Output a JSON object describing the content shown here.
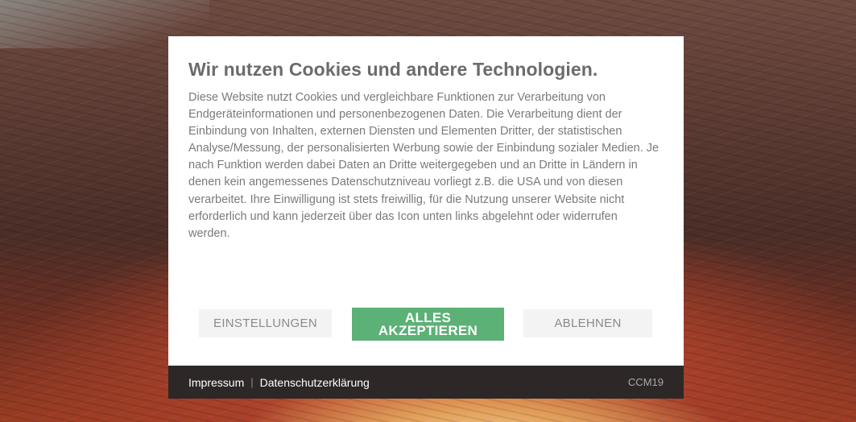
{
  "consent_modal": {
    "title": "Wir nutzen Cookies und andere Technologien.",
    "description": "Diese Website nutzt Cookies und vergleichbare Funktionen zur Verarbeitung von Endgeräteinformationen und personenbezogenen Daten. Die Verarbeitung dient der Einbindung von Inhalten, externen Diensten und Elementen Dritter, der statistischen Analyse/Messung, der personalisierten Werbung sowie der Einbindung sozialer Medien. Je nach Funktion werden dabei Daten an Dritte weitergegeben und an Dritte in Ländern in denen kein angemessenes Datenschutzniveau vorliegt z.B. die USA und von diesen verarbeitet. Ihre Einwilligung ist stets freiwillig, für die Nutzung unserer Website nicht erforderlich und kann jederzeit über das Icon unten links abgelehnt oder widerrufen werden.",
    "buttons": {
      "settings_label": "EINSTELLUNGEN",
      "accept_all_label": "ALLES AKZEPTIEREN",
      "reject_label": "ABLEHNEN"
    },
    "colors": {
      "accept_button": "#5cb176",
      "secondary_button": "#f3f3f3",
      "footer_background": "#2d2827"
    }
  },
  "footer": {
    "imprint_label": "Impressum",
    "separator": "|",
    "privacy_label": "Datenschutzerklärung",
    "brand": "CCM19"
  }
}
